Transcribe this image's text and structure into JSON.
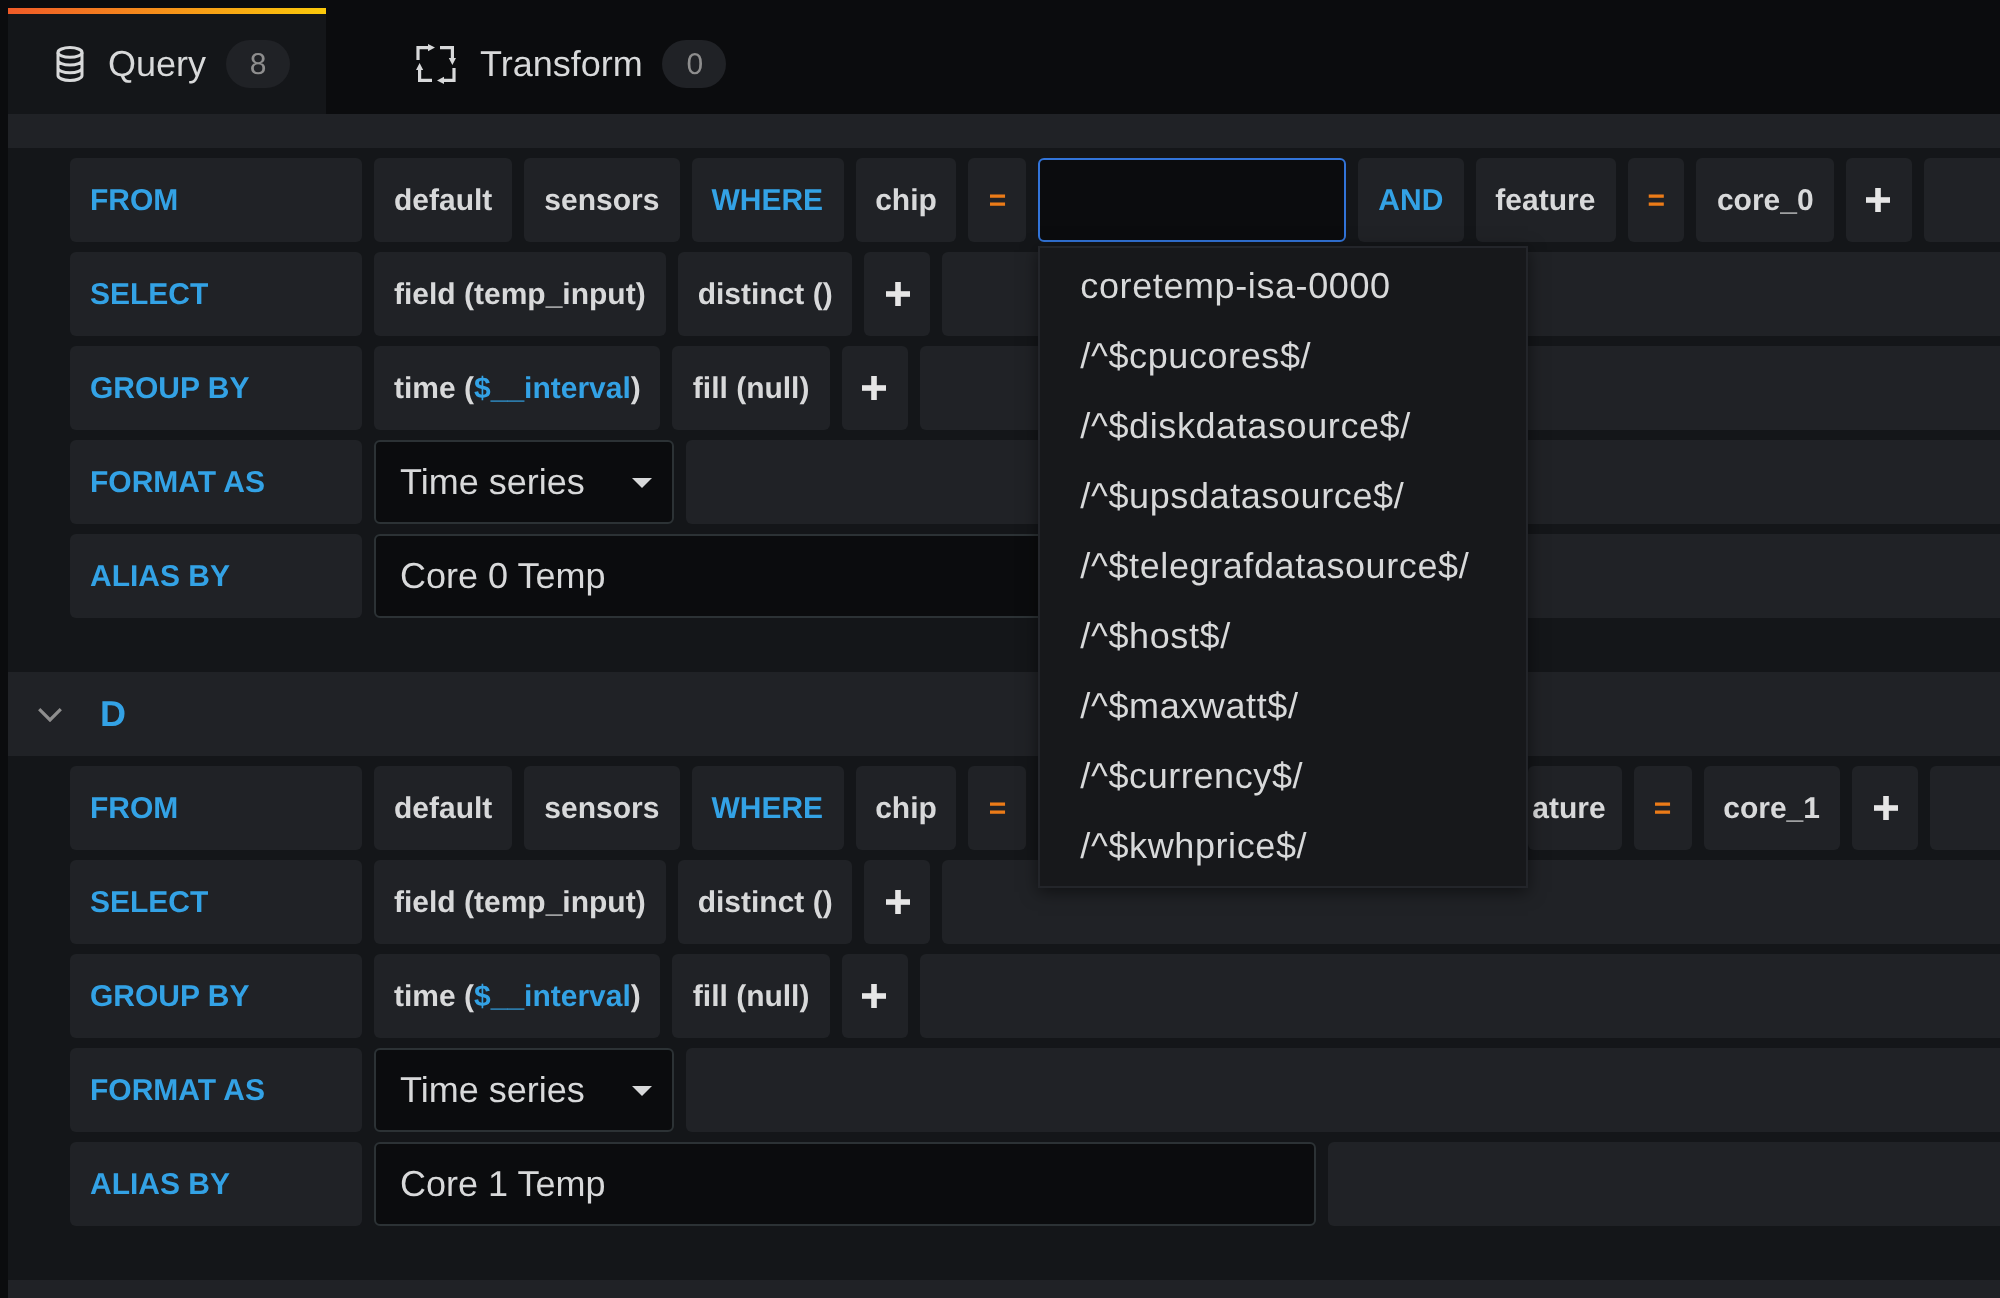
{
  "tabs": [
    {
      "kind": "query",
      "label": "Query",
      "count": "8",
      "selected": true
    },
    {
      "kind": "transform",
      "label": "Transform",
      "count": "0",
      "selected": false
    }
  ],
  "queries": [
    {
      "rows": [
        {
          "label": "FROM",
          "segments": [
            {
              "kind": "value",
              "text": "default"
            },
            {
              "kind": "value",
              "text": "sensors"
            },
            {
              "kind": "keyword",
              "text": "WHERE"
            },
            {
              "kind": "value",
              "text": "chip"
            },
            {
              "kind": "operator",
              "text": "="
            },
            {
              "kind": "input",
              "focused": true
            },
            {
              "kind": "keyword",
              "text": "AND"
            },
            {
              "kind": "value",
              "text": "feature"
            },
            {
              "kind": "operator",
              "text": "="
            },
            {
              "kind": "value",
              "text": "core_0"
            },
            {
              "kind": "add"
            }
          ]
        },
        {
          "label": "SELECT",
          "segments": [
            {
              "kind": "value",
              "text": "field (temp_input)"
            },
            {
              "kind": "value",
              "text": "distinct ()"
            },
            {
              "kind": "add"
            }
          ]
        },
        {
          "label": "GROUP BY",
          "segments": [
            {
              "kind": "value",
              "parts": [
                {
                  "kind": "text",
                  "text": "time ("
                },
                {
                  "kind": "variable",
                  "text": "$__interval"
                },
                {
                  "kind": "text",
                  "text": ")"
                }
              ]
            },
            {
              "kind": "value",
              "text": "fill (null)"
            },
            {
              "kind": "add"
            }
          ]
        },
        {
          "label": "FORMAT AS",
          "segments": [
            {
              "kind": "select",
              "value": "Time series"
            }
          ]
        },
        {
          "label": "ALIAS BY",
          "segments": [
            {
              "kind": "text_input",
              "value": "Core 0 Temp"
            }
          ]
        }
      ]
    },
    {
      "name": "D",
      "expanded": true,
      "rows": [
        {
          "label": "FROM",
          "segments": [
            {
              "kind": "value",
              "text": "default"
            },
            {
              "kind": "value",
              "text": "sensors"
            },
            {
              "kind": "keyword",
              "text": "WHERE"
            },
            {
              "kind": "value",
              "text": "chip"
            },
            {
              "kind": "operator",
              "text": "="
            },
            {
              "kind": "value",
              "text": "ature",
              "partly_hidden": true
            },
            {
              "kind": "operator",
              "text": "="
            },
            {
              "kind": "value",
              "text": "core_1"
            },
            {
              "kind": "add"
            }
          ]
        },
        {
          "label": "SELECT",
          "segments": [
            {
              "kind": "value",
              "text": "field (temp_input)"
            },
            {
              "kind": "value",
              "text": "distinct ()"
            },
            {
              "kind": "add"
            }
          ]
        },
        {
          "label": "GROUP BY",
          "segments": [
            {
              "kind": "value",
              "parts": [
                {
                  "kind": "text",
                  "text": "time ("
                },
                {
                  "kind": "variable",
                  "text": "$__interval"
                },
                {
                  "kind": "text",
                  "text": ")"
                }
              ]
            },
            {
              "kind": "value",
              "text": "fill (null)"
            },
            {
              "kind": "add"
            }
          ]
        },
        {
          "label": "FORMAT AS",
          "segments": [
            {
              "kind": "select",
              "value": "Time series"
            }
          ]
        },
        {
          "label": "ALIAS BY",
          "segments": [
            {
              "kind": "text_input",
              "value": "Core 1 Temp"
            }
          ]
        }
      ]
    }
  ],
  "dropdown": {
    "options": [
      {
        "text": "coretemp-isa-0000",
        "selected": false
      },
      {
        "text": "/^$cpucores$/",
        "selected": false
      },
      {
        "text": "/^$diskdatasource$/",
        "selected": false
      },
      {
        "text": "/^$upsdatasource$/",
        "selected": false
      },
      {
        "text": "/^$telegrafdatasource$/",
        "selected": false
      },
      {
        "text": "/^$host$/",
        "selected": false
      },
      {
        "text": "/^$maxwatt$/",
        "selected": false
      },
      {
        "text": "/^$currency$/",
        "selected": false
      },
      {
        "text": "/^$kwhprice$/",
        "selected": false
      }
    ]
  }
}
